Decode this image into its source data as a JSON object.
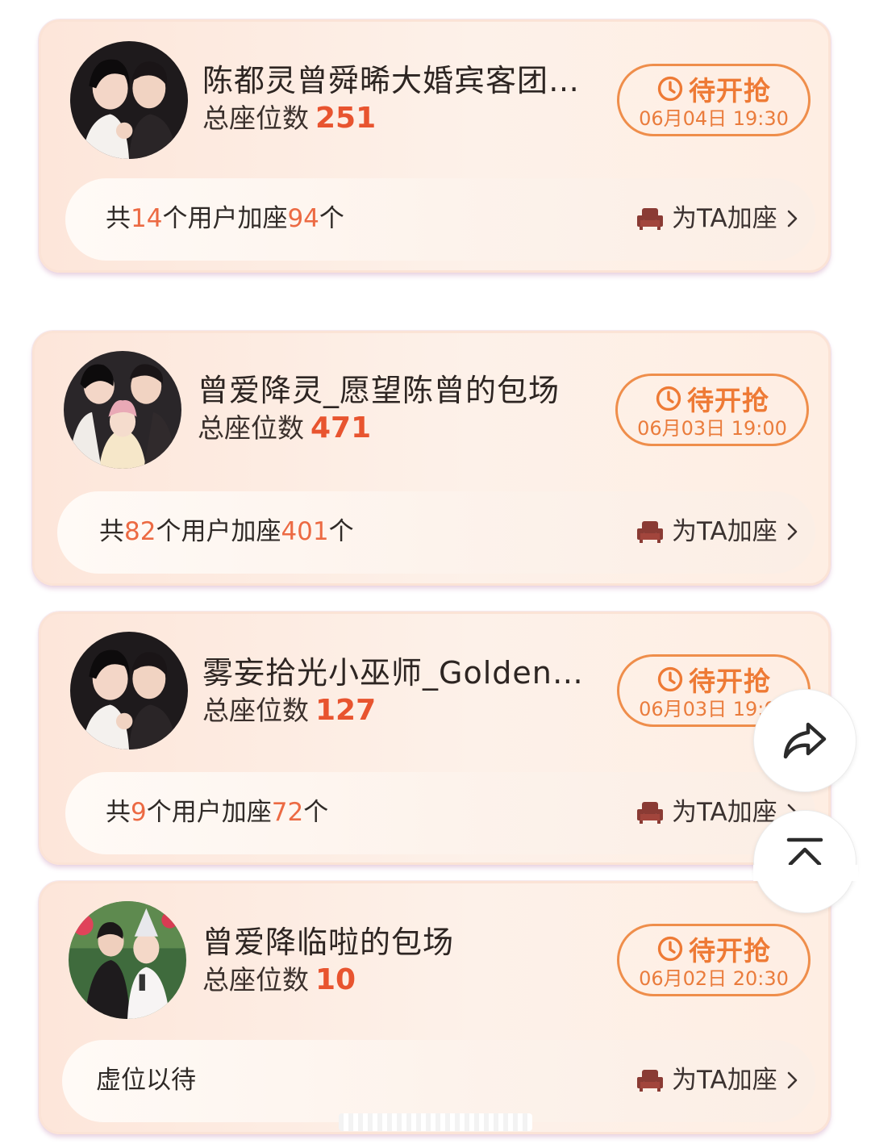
{
  "cards": [
    {
      "title": "陈都灵曾舜晞大婚宾客团…",
      "seats_label": "总座位数",
      "seats": "251",
      "grab_label": "待开抢",
      "grab_time": "06月04日 19:30",
      "stats": {
        "pre": "共",
        "users": "14",
        "mid": "个用户加座",
        "count": "94",
        "post": "个"
      },
      "add_label": "为TA加座"
    },
    {
      "title": "曾爱降灵_愿望陈曾的包场",
      "seats_label": "总座位数",
      "seats": "471",
      "grab_label": "待开抢",
      "grab_time": "06月03日 19:00",
      "stats": {
        "pre": "共",
        "users": "82",
        "mid": "个用户加座",
        "count": "401",
        "post": "个"
      },
      "add_label": "为TA加座"
    },
    {
      "title": "雾妄拾光小巫师_Golden…",
      "seats_label": "总座位数",
      "seats": "127",
      "grab_label": "待开抢",
      "grab_time": "06月03日 19:00",
      "stats": {
        "pre": "共",
        "users": "9",
        "mid": "个用户加座",
        "count": "72",
        "post": "个"
      },
      "add_label": "为TA加座"
    },
    {
      "title": "曾爱降临啦的包场",
      "seats_label": "总座位数",
      "seats": "10",
      "grab_label": "待开抢",
      "grab_time": "06月02日 20:30",
      "empty_text": "虚位以待",
      "add_label": "为TA加座"
    }
  ],
  "icons": {
    "clock": "clock-icon",
    "sofa": "sofa-icon",
    "chevron": "chevron-right-icon",
    "share": "share-icon",
    "top": "back-to-top-icon"
  },
  "colors": {
    "accent": "#ec6a43",
    "button_border": "#ef8e4b",
    "card_bg": "#fde6da"
  }
}
